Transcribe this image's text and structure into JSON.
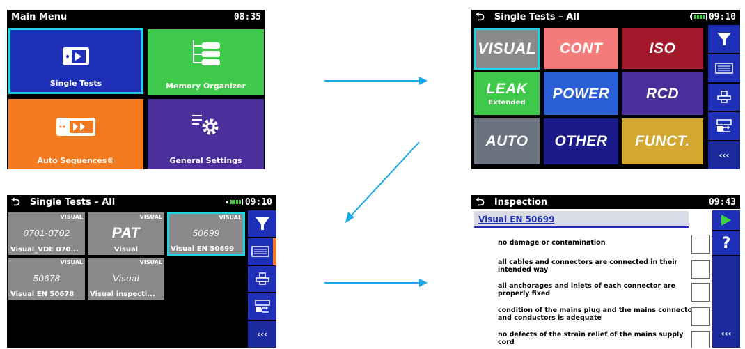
{
  "screen1": {
    "title": "Main Menu",
    "time": "08:35",
    "tiles": [
      {
        "label": "Single Tests",
        "color": "#1e2fb8"
      },
      {
        "label": "Memory Organizer",
        "color": "#3fc94a"
      },
      {
        "label": "Auto Sequences®",
        "color": "#f47a1f"
      },
      {
        "label": "General Settings",
        "color": "#4a2e9a"
      }
    ]
  },
  "screen2": {
    "title": "Single Tests – All",
    "time": "09:10",
    "tiles": [
      {
        "label": "VISUAL",
        "color": "#8a8a8a"
      },
      {
        "label": "CONT",
        "color": "#f47b7b"
      },
      {
        "label": "ISO",
        "color": "#a3192b"
      },
      {
        "label": "LEAK",
        "sub": "Extended",
        "color": "#3fc94a"
      },
      {
        "label": "POWER",
        "color": "#2b5fd8"
      },
      {
        "label": "RCD",
        "color": "#4a2e9a"
      },
      {
        "label": "AUTO",
        "color": "#6b7280"
      },
      {
        "label": "OTHER",
        "color": "#1a1a8a"
      },
      {
        "label": "FUNCT.",
        "color": "#d4a830"
      }
    ],
    "more": "‹‹‹"
  },
  "screen3": {
    "title": "Single Tests – All",
    "time": "09:10",
    "tiles": [
      {
        "tag": "VISUAL",
        "main": "0701-0702",
        "sub": "Visual_VDE 070..."
      },
      {
        "tag": "VISUAL",
        "main": "PAT",
        "sub": "Visual"
      },
      {
        "tag": "VISUAL",
        "main": "50699",
        "sub": "Visual EN 50699"
      },
      {
        "tag": "VISUAL",
        "main": "50678",
        "sub": "Visual EN 50678"
      },
      {
        "tag": "VISUAL",
        "main": "Visual",
        "sub": "Visual inspecti..."
      }
    ],
    "more": "‹‹‹"
  },
  "screen4": {
    "title": "Inspection",
    "time": "09:43",
    "heading": "Visual EN 50699",
    "help": "?",
    "more": "‹‹‹",
    "items": [
      "no damage or contamination",
      "all cables and connectors are connected in their intended way",
      "all anchorages and inlets of each connector are properly fixed",
      "condition of the mains plug and the mains connectors and conductors is adequate",
      "no defects of the strain relief of the mains supply cord"
    ]
  }
}
